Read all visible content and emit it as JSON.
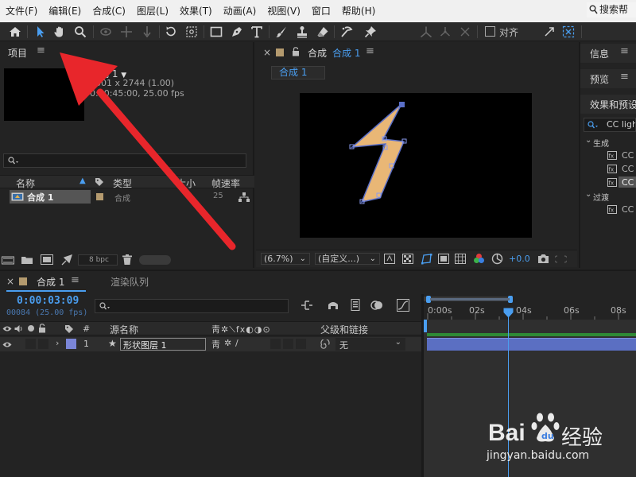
{
  "menu": [
    "文件(F)",
    "编辑(E)",
    "合成(C)",
    "图层(L)",
    "效果(T)",
    "动画(A)",
    "视图(V)",
    "窗口",
    "帮助(H)"
  ],
  "toolbar": {
    "snap_label": "对齐",
    "search_help_label": "搜索帮"
  },
  "project": {
    "tab_label": "项目",
    "comp_name": "合成 1",
    "comp_size": "2001 x 2744 (1.00)",
    "comp_duration": "0:00:45:00, 25.00 fps",
    "columns": {
      "name": "名称",
      "type": "类型",
      "size": "大小",
      "fps": "帧速率"
    },
    "row": {
      "name": "合成 1",
      "type": "合成",
      "fps": "25"
    },
    "bpc_label": "8 bpc"
  },
  "composition": {
    "tab_close": "×",
    "tab_label": "合成",
    "tab_comp": "合成 1",
    "subtab": "合成 1",
    "zoom": "(6.7%)",
    "resolution": "(自定义...)",
    "exposure": "+0.0"
  },
  "right_panels": {
    "info": "信息",
    "preview": "预览",
    "effects": "效果和预设",
    "search_value": "CC light",
    "group1": "生成",
    "group2": "过渡",
    "items": [
      "CC",
      "CC",
      "CC",
      "CC"
    ]
  },
  "timeline": {
    "tab_close": "×",
    "tab_label": "合成 1",
    "render_queue": "渲染队列",
    "time": "0:00:03:09",
    "frames": "00084 (25.00 fps)",
    "col_hash": "#",
    "col_source_name": "源名称",
    "col_parent": "父级和链接",
    "layer": {
      "index": "1",
      "name": "形状图层 1",
      "parent": "无"
    },
    "ruler": [
      "0:00s",
      "02s",
      "04s",
      "06s",
      "08s"
    ]
  },
  "watermark": {
    "brand_text": "Bai",
    "brand_text2": "经验",
    "url": "jingyan.baidu.com"
  },
  "colors": {
    "accent": "#4a9ef0",
    "shape_fill": "#e9b776",
    "layer_bar": "#5b6fc2",
    "arrow_red": "#e8262b",
    "label_tan": "#b49a6e"
  }
}
